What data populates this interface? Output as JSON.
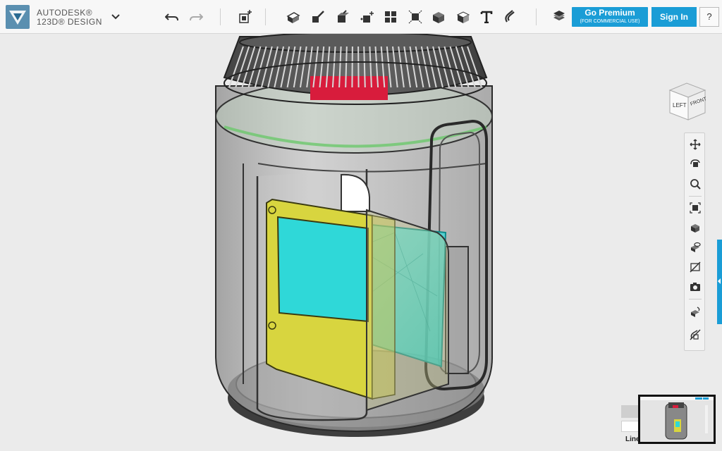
{
  "app": {
    "brand_line1": "AUTODESK®",
    "brand_line2": "123D® DESIGN",
    "menu_icon": "chevron-down-icon"
  },
  "toolbar": {
    "tools": [
      "undo-icon",
      "redo-icon",
      "primitives-icon",
      "sketch-icon",
      "construct-icon",
      "modify-icon",
      "pattern-icon",
      "grouping-icon",
      "combine-icon",
      "measure-icon",
      "text-icon",
      "snap-icon",
      "material-icon"
    ],
    "premium_label": "Go Premium",
    "premium_sublabel": "(FOR COMMERCIAL USE)",
    "signin_label": "Sign In",
    "help_label": "?"
  },
  "viewcube": {
    "left_label": "LEFT",
    "front_label": "FRONT"
  },
  "navbar": {
    "tools": [
      "pan-icon",
      "orbit-icon",
      "zoom-icon",
      "fit-icon",
      "views-icon",
      "visibility-icon",
      "hide-sketch-icon",
      "screenshot-icon",
      "material-toggle-icon",
      "hide-mesh-icon"
    ]
  },
  "status": {
    "lines_label": "Line"
  },
  "colors": {
    "accent": "#1a9dd6",
    "yellow_part": "#d8d53f",
    "cyan_part": "#2fd8d8"
  }
}
